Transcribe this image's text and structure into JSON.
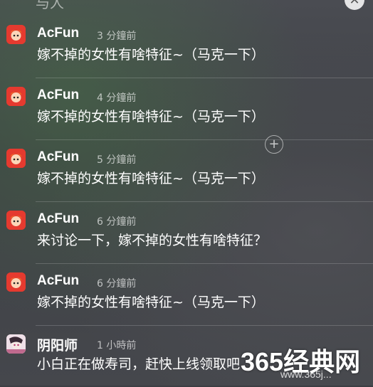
{
  "header": {
    "partial_text": "与人"
  },
  "notifications": [
    {
      "app": "AcFun",
      "time": "3 分鐘前",
      "message": "嫁不掉的女性有啥特征~（马克一下）",
      "icon": "acfun-icon"
    },
    {
      "app": "AcFun",
      "time": "4 分鐘前",
      "message": "嫁不掉的女性有啥特征~（马克一下）",
      "icon": "acfun-icon"
    },
    {
      "app": "AcFun",
      "time": "5 分鐘前",
      "message": "嫁不掉的女性有啥特征~（马克一下）",
      "icon": "acfun-icon"
    },
    {
      "app": "AcFun",
      "time": "6 分鐘前",
      "message": "来讨论一下，嫁不掉的女性有啥特征？",
      "icon": "acfun-icon"
    },
    {
      "app": "AcFun",
      "time": "6 分鐘前",
      "message": "嫁不掉的女性有啥特征~（马克一下）",
      "icon": "acfun-icon"
    },
    {
      "app": "阴阳师",
      "time": "1 小時前",
      "message": "小白正在做寿司，赶快上线领取吧",
      "icon": "onmyoji-icon"
    }
  ],
  "watermark": {
    "main": "365经典网",
    "sub": "www.365j..."
  },
  "colors": {
    "acfun_red": "#e53a2f",
    "background": "#3c3e43"
  }
}
